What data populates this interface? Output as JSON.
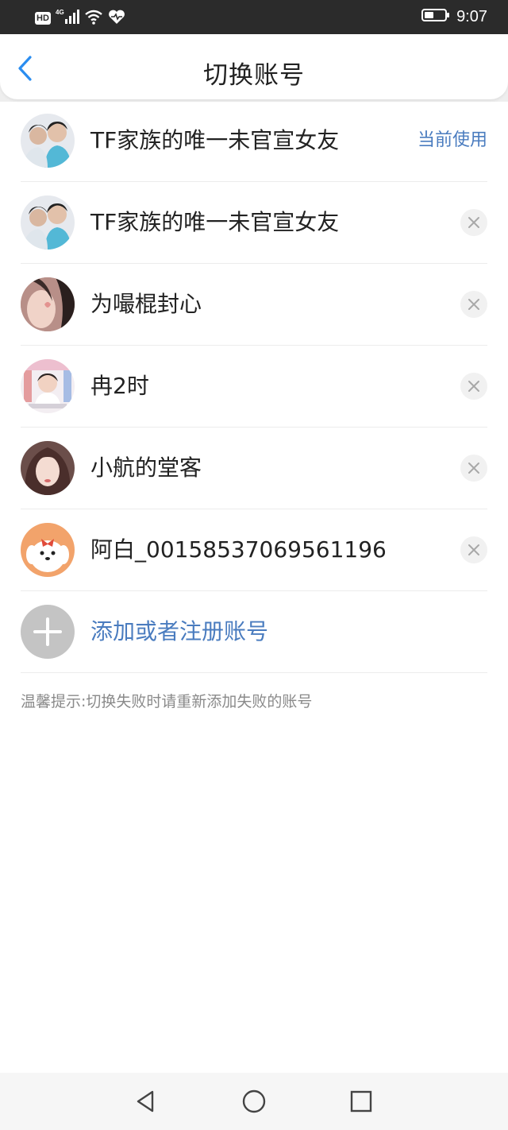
{
  "status_bar": {
    "network_badge": "HD",
    "network_type": "4G",
    "time": "9:07",
    "icons": [
      "hd-icon",
      "signal-icon",
      "wifi-icon",
      "heart-rate-icon",
      "battery-icon"
    ]
  },
  "header": {
    "title": "切换账号",
    "back_icon": "chevron-left-icon"
  },
  "accounts": [
    {
      "name": "TF家族的唯一未官宣女友",
      "status": "当前使用",
      "current": true
    },
    {
      "name": "TF家族的唯一未官宣女友",
      "current": false
    },
    {
      "name": "为嘬棍封心",
      "current": false
    },
    {
      "name": "冉2时",
      "current": false
    },
    {
      "name": "小航的堂客",
      "current": false
    },
    {
      "name": "阿白_0015853706956​1196",
      "current": false
    }
  ],
  "add_account": {
    "label": "添加或者注册账号",
    "icon": "plus-icon"
  },
  "tip": "温馨提示:切换失败时请重新添加失败的账号",
  "colors": {
    "accent_blue": "#4a7cbf",
    "back_arrow": "#2a8df0",
    "status_bar_bg": "#2b2b2b",
    "add_circle": "#c4c4c4"
  },
  "nav_bar": {
    "icons": [
      "back-triangle-icon",
      "home-circle-icon",
      "recents-square-icon"
    ]
  }
}
